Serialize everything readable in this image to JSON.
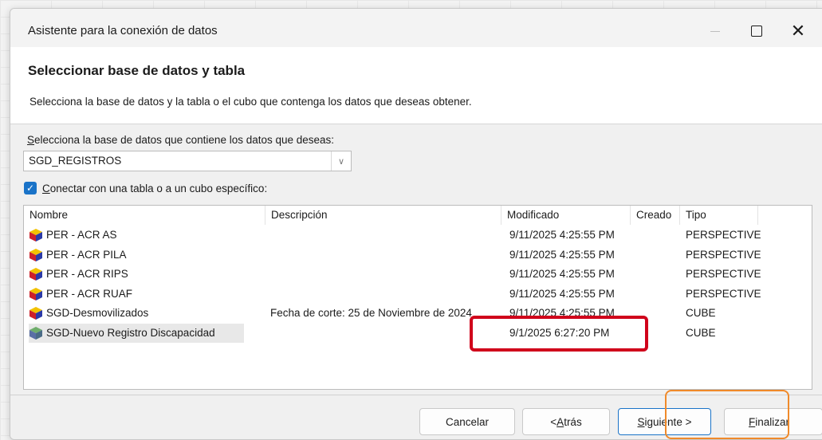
{
  "window": {
    "title": "Asistente para la conexión de datos",
    "maximize_glyph": "maximize-icon",
    "close_glyph": "✕"
  },
  "header": {
    "heading": "Seleccionar base de datos y tabla",
    "subtitle": "Selecciona la base de datos y la tabla o el cubo que contenga los datos que deseas obtener."
  },
  "database": {
    "label_accel": "S",
    "label_rest": "elecciona la base de datos que contiene los datos que deseas:",
    "selected": "SGD_REGISTROS"
  },
  "connect_checkbox": {
    "checked": true,
    "label_accel": "C",
    "label_rest": "onectar con una tabla o a un cubo específico:"
  },
  "table": {
    "columns": [
      "Nombre",
      "Descripción",
      "Modificado",
      "Creado",
      "Tipo"
    ],
    "rows": [
      {
        "name": "PER - ACR AS",
        "description": "",
        "modified": "9/11/2025 4:25:55 PM",
        "created": "",
        "type": "PERSPECTIVE",
        "icon": "perspective-icon"
      },
      {
        "name": "PER - ACR PILA",
        "description": "",
        "modified": "9/11/2025 4:25:55 PM",
        "created": "",
        "type": "PERSPECTIVE",
        "icon": "perspective-icon"
      },
      {
        "name": "PER - ACR RIPS",
        "description": "",
        "modified": "9/11/2025 4:25:55 PM",
        "created": "",
        "type": "PERSPECTIVE",
        "icon": "perspective-icon"
      },
      {
        "name": "PER - ACR RUAF",
        "description": "",
        "modified": "9/11/2025 4:25:55 PM",
        "created": "",
        "type": "PERSPECTIVE",
        "icon": "perspective-icon"
      },
      {
        "name": "SGD-Desmovilizados",
        "description": "Fecha de corte:  25 de Noviembre de 2024",
        "modified": "9/11/2025 4:25:55 PM",
        "created": "",
        "type": "CUBE",
        "icon": "cube-icon"
      },
      {
        "name": "SGD-Nuevo Registro Discapacidad",
        "description": "",
        "modified": "9/1/2025 6:27:20 PM",
        "created": "",
        "type": "CUBE",
        "icon": "cube-icon"
      }
    ]
  },
  "buttons": {
    "cancel": "Cancelar",
    "back_prefix": "< ",
    "back_accel": "A",
    "back_rest": "trás",
    "next_accel": "S",
    "next_rest": "iguiente >",
    "finish_accel": "F",
    "finish_rest": "inalizar"
  },
  "colors": {
    "accent": "#1a73c8",
    "highlight_red": "#d0021b",
    "highlight_orange": "#f08a2a"
  }
}
